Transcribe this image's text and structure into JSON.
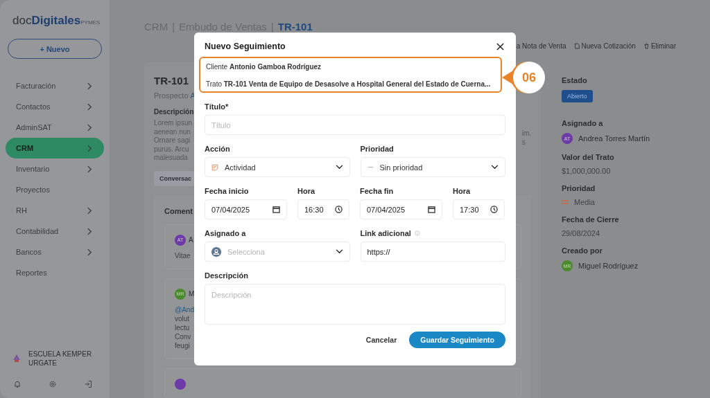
{
  "sidebar": {
    "logo": {
      "prefix": "doc",
      "name": "Digitales",
      "suffix": "PYMES"
    },
    "new_button": "+ Nuevo",
    "items": [
      {
        "label": "Facturación",
        "selected": false,
        "has_submenu": true
      },
      {
        "label": "Contactos",
        "selected": false,
        "has_submenu": true
      },
      {
        "label": "AdminSAT",
        "selected": false,
        "has_submenu": true
      },
      {
        "label": "CRM",
        "selected": true,
        "has_submenu": true
      },
      {
        "label": "Inventario",
        "selected": false,
        "has_submenu": true
      },
      {
        "label": "Proyectos",
        "selected": false,
        "has_submenu": false
      },
      {
        "label": "RH",
        "selected": false,
        "has_submenu": true
      },
      {
        "label": "Contabilidad",
        "selected": false,
        "has_submenu": true
      },
      {
        "label": "Bancos",
        "selected": false,
        "has_submenu": true
      },
      {
        "label": "Reportes",
        "selected": false,
        "has_submenu": false
      }
    ],
    "organization": "ESCUELA KEMPER URGATE"
  },
  "header": {
    "separator": "|",
    "breadcrumb": [
      {
        "label": "CRM",
        "current": false
      },
      {
        "label": "Embudo de Ventas",
        "current": false
      },
      {
        "label": "TR-101",
        "current": true
      }
    ],
    "actions": [
      {
        "label": "a Nota de Venta",
        "kind": "plain"
      },
      {
        "label": "Nueva Cotización",
        "kind": "document"
      },
      {
        "label": "Eliminar",
        "kind": "trash"
      }
    ]
  },
  "deal": {
    "title": "TR-101",
    "prospect_label": "Prospecto",
    "prospect_link": "A",
    "description_label": "Descripción",
    "description_left": [
      "Lorem ipsun",
      "aenean nun",
      "Ornare sagi",
      "purus. Arcu",
      "malesuada"
    ],
    "description_right": [
      "im.",
      "s"
    ],
    "tab": "Conversac",
    "comments_title": "Coment",
    "comments": [
      {
        "initials": "AT",
        "color": "#6e3aa8",
        "author": "A",
        "lines": [
          {
            "text": "Vitae",
            "kind": "text"
          }
        ]
      },
      {
        "initials": "MR",
        "color": "#4a8a2c",
        "author": "M",
        "lines": [
          {
            "text": "@And",
            "kind": "mention"
          },
          {
            "text": "volut",
            "kind": "text"
          },
          {
            "text": "lectu",
            "kind": "text"
          },
          {
            "text": "Conv",
            "kind": "text"
          },
          {
            "text": "feugi",
            "kind": "text"
          }
        ]
      },
      {
        "color": "#6e3aa8"
      }
    ]
  },
  "details": {
    "status_label": "Estado",
    "status": "Abierto",
    "fields": [
      {
        "label": "Asignado a",
        "kind": "person",
        "value": "Andrea Torres Martín",
        "initials": "AT",
        "color": "#6e3aa8"
      },
      {
        "label": "Valor del Trato",
        "kind": "text",
        "value": "$1,000,000.00"
      },
      {
        "label": "Prioridad",
        "kind": "priority",
        "value": "Media"
      },
      {
        "label": "Fecha de Cierre",
        "kind": "text",
        "value": "29/08/2024"
      },
      {
        "label": "Creado por",
        "kind": "person",
        "value": "Miguel Rodríguez",
        "initials": "MR",
        "color": "#4a8a2c"
      }
    ]
  },
  "modal": {
    "title": "Nuevo Seguimiento",
    "callout": "06",
    "context": {
      "highlighted": true,
      "client": "Cliente **Antonio Gamboa Rodríguez**",
      "deal": "Trato **TR-101 Venta de Equipo de Desasolve a Hospital General del Estado de Cuerna...**"
    },
    "title_field": {
      "label": "Título*",
      "placeholder": "Título"
    },
    "action": {
      "label": "Acción",
      "value": "Actividad"
    },
    "priority": {
      "label": "Prioridad",
      "value": "Sin prioridad"
    },
    "start_date": {
      "label": "Fecha inicio",
      "value": "07/04/2025"
    },
    "start_time": {
      "label": "Hora",
      "value": "16:30"
    },
    "end_date": {
      "label": "Fecha fin",
      "value": "07/04/2025"
    },
    "end_time": {
      "label": "Hora",
      "value": "17:30"
    },
    "assignee": {
      "label": "Asignado a",
      "placeholder": "Selecciona"
    },
    "link": {
      "label": "Link adicional",
      "value": "https://"
    },
    "description": {
      "label": "Descripción",
      "placeholder": "Descripción"
    },
    "buttons": {
      "cancel": "Cancelar",
      "save": "Guardar Seguimiento"
    }
  }
}
